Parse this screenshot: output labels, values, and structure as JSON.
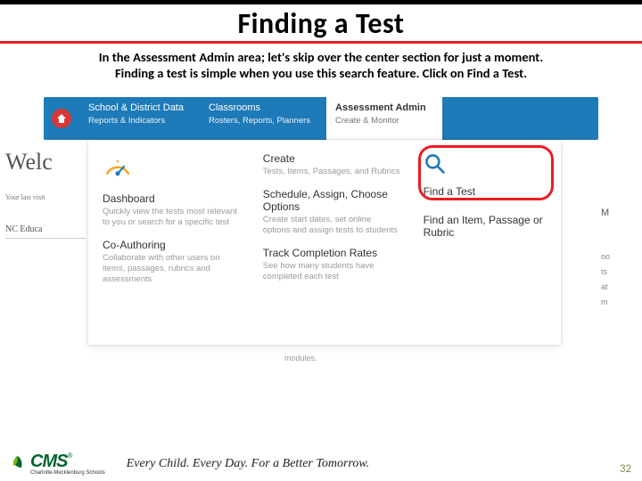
{
  "title": "Finding a Test",
  "intro": {
    "line1": "In the Assessment Admin area; let's skip over the center section for just a moment.",
    "line2_a": "Finding a test is simple when you use this search feature.  Click on ",
    "line2_b": "Find a Test."
  },
  "nav": {
    "items": [
      {
        "title": "School & District Data",
        "sub": "Reports & Indicators"
      },
      {
        "title": "Classrooms",
        "sub": "Rosters, Reports, Planners"
      },
      {
        "title": "Assessment Admin",
        "sub": "Create & Monitor"
      }
    ]
  },
  "panel": {
    "col1": {
      "dashboard_title": "Dashboard",
      "dashboard_sub": "Quickly view the tests most relevant to you or search for a specific test",
      "coauth_title": "Co-Authoring",
      "coauth_sub": "Collaborate with other users on items, passages, rubrics and assessments"
    },
    "col2": {
      "create_title": "Create",
      "create_sub": "Tests, Items, Passages, and Rubrics",
      "sched_title": "Schedule, Assign, Choose Options",
      "sched_sub": "Create start dates, set online options and assign tests to students",
      "track_title": "Track Completion Rates",
      "track_sub": "See how many students have completed each test"
    },
    "col3": {
      "find_test": "Find a Test",
      "find_item": "Find an Item, Passage or Rubric"
    }
  },
  "behind": {
    "welcome": "Welc",
    "last_visit": "Your last visit",
    "nc": "NC Educa",
    "right_head": "M",
    "r1": "oo",
    "r2": "ts",
    "r3": "at",
    "r4": "m",
    "below": "modules."
  },
  "footer": {
    "logo": "CMS",
    "logo_sub": "Charlotte-Mecklenburg Schools",
    "reg": "®",
    "tagline": "Every Child. Every Day. For a Better Tomorrow.",
    "page": "32"
  },
  "colors": {
    "red": "#ed1c24",
    "blue": "#1e7ab8",
    "green": "#00652e",
    "orange": "#f5a623"
  }
}
